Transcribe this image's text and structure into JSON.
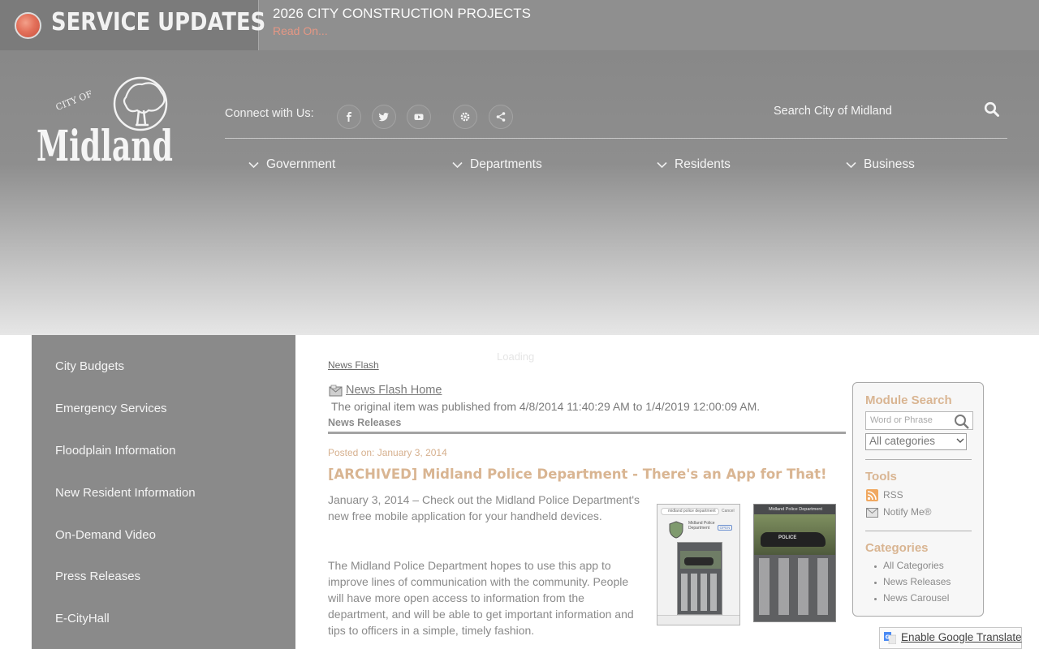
{
  "alert": {
    "title": "SERVICE UPDATES",
    "headline": "2026 CITY CONSTRUCTION PROJECTS",
    "read_on": "Read On..."
  },
  "header": {
    "logo": {
      "city_of": "CITY OF",
      "name": "Midland"
    },
    "connect_label": "Connect with Us:",
    "social_icons": [
      "facebook-icon",
      "twitter-icon",
      "youtube-icon",
      "settings-icon",
      "share-icon"
    ],
    "search_placeholder": "Search City of Midland",
    "nav": [
      "Government",
      "Departments",
      "Residents",
      "Business"
    ]
  },
  "sidebar": {
    "items": [
      "City Budgets",
      "Emergency Services",
      "Floodplain Information",
      "New Resident Information",
      "On-Demand Video",
      "Press Releases",
      "E-CityHall"
    ]
  },
  "main": {
    "loading": "Loading",
    "breadcrumb": "News Flash",
    "news_flash_home": "News Flash Home",
    "original_note": "The original item was published from 4/8/2014 11:40:29 AM to 1/4/2019 12:00:09 AM.",
    "section_label": "News Releases",
    "posted": "Posted on: January 3, 2014",
    "title": "[ARCHIVED] Midland Police Department - There's an App for That!",
    "para1": "January 3, 2014 – Check out the Midland Police Department's new free mobile application for your handheld devices.",
    "para2": "The Midland Police Department hopes to use this app to improve lines of communication with the community. People will have more open access to information from the department, and will be able to get important information and tips to officers in a simple, timely fashion.",
    "phone1": {
      "search": "midland police department",
      "cancel": "Cancel",
      "app_name": "Midland Police Department",
      "open": "OPEN"
    },
    "phone2": {
      "header": "Midland Police Department"
    }
  },
  "module": {
    "search_heading": "Module Search",
    "search_placeholder": "Word or Phrase",
    "category_select": "All categories",
    "tools_heading": "Tools",
    "tools": [
      "RSS",
      "Notify Me®"
    ],
    "categories_heading": "Categories",
    "categories": [
      "All Categories",
      "News Releases",
      "News Carousel"
    ]
  },
  "translate": {
    "label": "Enable Google Translate"
  },
  "colors": {
    "accent": "#d9b592",
    "alert_red": "#e3705a",
    "sidebar": "#8a8a8a"
  }
}
